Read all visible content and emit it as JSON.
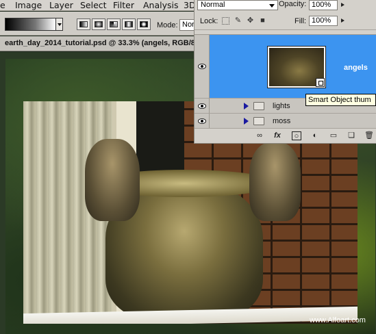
{
  "menu": {
    "items": [
      "e",
      "Image",
      "Layer",
      "Select",
      "Filter",
      "Analysis",
      "3D"
    ]
  },
  "options_bar": {
    "mode_label": "Mode:",
    "mode_value": "Nor"
  },
  "document": {
    "tab_title": "earth_day_2014_tutorial.psd @ 33.3% (angels, RGB/8"
  },
  "canvas": {
    "watermark": "www.Alfoart.com"
  },
  "layers_panel": {
    "blend_mode": "Normal",
    "opacity_label": "Opacity:",
    "opacity_value": "100%",
    "lock_label": "Lock:",
    "fill_label": "Fill:",
    "fill_value": "100%",
    "layers": [
      {
        "name": "angels",
        "type": "smart-object",
        "selected": true,
        "visible": true
      },
      {
        "name": "lights",
        "type": "group",
        "selected": false,
        "visible": true
      },
      {
        "name": "moss",
        "type": "group",
        "selected": false,
        "visible": true
      }
    ],
    "tooltip": "Smart Object thum"
  },
  "colors": {
    "selection": "#3c94f0",
    "panel_bg": "#d4d1cb",
    "tooltip_bg": "#ffffe1"
  },
  "icons": {
    "lock_icons": [
      "lock-transparent-icon",
      "lock-brush-icon",
      "lock-move-icon",
      "lock-all-icon"
    ],
    "footer_icons": [
      "link-layers-icon",
      "fx-icon",
      "add-mask-icon",
      "adjustment-layer-icon",
      "new-group-icon",
      "new-layer-icon",
      "trash-icon"
    ]
  }
}
